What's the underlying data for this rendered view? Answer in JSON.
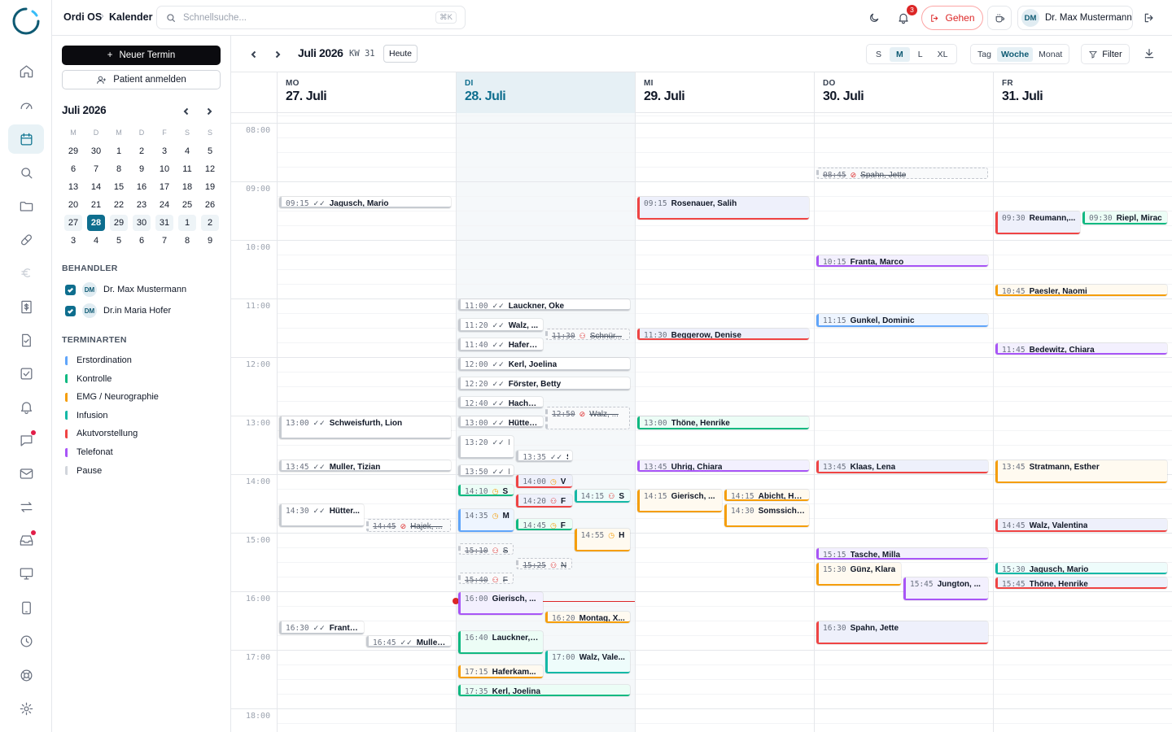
{
  "app": {
    "name": "Ordi OS",
    "page": "Kalender"
  },
  "search": {
    "placeholder": "Schnellsuche...",
    "shortcut": "⌘K"
  },
  "notifications": {
    "count": "3"
  },
  "header": {
    "gehen_label": "Gehen",
    "user_initials": "DM",
    "user_name": "Dr. Max Mustermann"
  },
  "sidebar": {
    "new_appointment": "Neuer Termin",
    "register_patient": "Patient anmelden",
    "mini_month": "Juli 2026",
    "weekdays": [
      "M",
      "D",
      "M",
      "D",
      "F",
      "S",
      "S"
    ],
    "weeks": [
      [
        "29",
        "30",
        "1",
        "2",
        "3",
        "4",
        "5"
      ],
      [
        "6",
        "7",
        "8",
        "9",
        "10",
        "11",
        "12"
      ],
      [
        "13",
        "14",
        "15",
        "16",
        "17",
        "18",
        "19"
      ],
      [
        "20",
        "21",
        "22",
        "23",
        "24",
        "25",
        "26"
      ],
      [
        "27",
        "28",
        "29",
        "30",
        "31",
        "1",
        "2"
      ],
      [
        "3",
        "4",
        "5",
        "6",
        "7",
        "8",
        "9"
      ]
    ],
    "providers_title": "BEHANDLER",
    "providers": [
      {
        "initials": "DM",
        "name": "Dr. Max Mustermann",
        "checked": true
      },
      {
        "initials": "DM",
        "name": "Dr.in Maria Hofer",
        "checked": true
      }
    ],
    "types_title": "TERMINARTEN",
    "types": [
      {
        "name": "Erstordination",
        "color": "#60a5fa"
      },
      {
        "name": "Kontrolle",
        "color": "#10b981"
      },
      {
        "name": "EMG / Neurographie",
        "color": "#f59e0b"
      },
      {
        "name": "Infusion",
        "color": "#14b8a6"
      },
      {
        "name": "Akutvorstellung",
        "color": "#ef4444"
      },
      {
        "name": "Telefonat",
        "color": "#a855f7"
      },
      {
        "name": "Pause",
        "color": "#d1d5db"
      }
    ]
  },
  "calendar": {
    "month_label": "Juli 2026",
    "week_label": "KW 31",
    "today_label": "Heute",
    "sizes": [
      "S",
      "M",
      "L",
      "XL"
    ],
    "active_size": "M",
    "views": [
      "Tag",
      "Woche",
      "Monat"
    ],
    "active_view": "Woche",
    "filter_label": "Filter",
    "days": [
      {
        "weekday": "MO",
        "date": "27. Juli",
        "today": false
      },
      {
        "weekday": "DI",
        "date": "28. Juli",
        "today": true
      },
      {
        "weekday": "MI",
        "date": "29. Juli",
        "today": false
      },
      {
        "weekday": "DO",
        "date": "30. Juli",
        "today": false
      },
      {
        "weekday": "FR",
        "date": "31. Juli",
        "today": false
      }
    ],
    "hours": [
      "08:00",
      "09:00",
      "10:00",
      "11:00",
      "12:00",
      "13:00",
      "14:00",
      "15:00",
      "16:00",
      "17:00",
      "18:00"
    ],
    "appointments": [
      {
        "day": 0,
        "start": "09:15",
        "mins": 12,
        "lane": 0,
        "lanes": 1,
        "name": "Jagusch, Mario",
        "status": "check",
        "kind": "pause"
      },
      {
        "day": 0,
        "start": "13:00",
        "mins": 25,
        "lane": 0,
        "lanes": 1,
        "name": "Schweisfurth, Lion",
        "status": "check",
        "kind": "pause"
      },
      {
        "day": 0,
        "start": "13:45",
        "mins": 12,
        "lane": 0,
        "lanes": 1,
        "name": "Muller, Tizian",
        "status": "check",
        "kind": "pause"
      },
      {
        "day": 0,
        "start": "14:30",
        "mins": 25,
        "lane": 0,
        "lanes": 2,
        "name": "Hütter...",
        "status": "check",
        "kind": "pause"
      },
      {
        "day": 0,
        "start": "14:45",
        "mins": 15,
        "lane": 1,
        "lanes": 2,
        "name": "Hajek, ...",
        "status": "noshow",
        "kind": "cancel"
      },
      {
        "day": 0,
        "start": "16:30",
        "mins": 15,
        "lane": 0,
        "lanes": 2,
        "name": "Franta,...",
        "status": "check",
        "kind": "pause"
      },
      {
        "day": 0,
        "start": "16:45",
        "mins": 12,
        "lane": 1,
        "lanes": 2,
        "name": "Muller, ...",
        "status": "check",
        "kind": "pause"
      },
      {
        "day": 1,
        "start": "11:00",
        "mins": 12,
        "lane": 0,
        "lanes": 1,
        "name": "Lauckner, Oke",
        "status": "check",
        "kind": "pause"
      },
      {
        "day": 1,
        "start": "11:20",
        "mins": 15,
        "lane": 0,
        "lanes": 2,
        "name": "Walz, ...",
        "status": "check",
        "kind": "pause"
      },
      {
        "day": 1,
        "start": "11:30",
        "mins": 12,
        "lane": 1,
        "lanes": 2,
        "name": "Schnür...",
        "status": "person",
        "kind": "cancel"
      },
      {
        "day": 1,
        "start": "11:40",
        "mins": 15,
        "lane": 0,
        "lanes": 2,
        "name": "Haferk...",
        "status": "check",
        "kind": "pause"
      },
      {
        "day": 1,
        "start": "12:00",
        "mins": 15,
        "lane": 0,
        "lanes": 1,
        "name": "Kerl, Joelina",
        "status": "check",
        "kind": "pause"
      },
      {
        "day": 1,
        "start": "12:20",
        "mins": 15,
        "lane": 0,
        "lanes": 1,
        "name": "Förster, Betty",
        "status": "check",
        "kind": "pause"
      },
      {
        "day": 1,
        "start": "12:40",
        "mins": 12,
        "lane": 0,
        "lanes": 2,
        "name": "Hache,...",
        "status": "check",
        "kind": "pause"
      },
      {
        "day": 1,
        "start": "12:50",
        "mins": 25,
        "lane": 1,
        "lanes": 2,
        "name": "Walz, ...",
        "status": "noshow",
        "kind": "cancel"
      },
      {
        "day": 1,
        "start": "13:00",
        "mins": 12,
        "lane": 0,
        "lanes": 2,
        "name": "Hütter,...",
        "status": "check",
        "kind": "pause"
      },
      {
        "day": 1,
        "start": "13:20",
        "mins": 25,
        "lane": 0,
        "lanes": 3,
        "name": "F",
        "status": "check",
        "kind": "pause"
      },
      {
        "day": 1,
        "start": "13:35",
        "mins": 12,
        "lane": 1,
        "lanes": 3,
        "name": "S",
        "status": "check",
        "kind": "pause"
      },
      {
        "day": 1,
        "start": "13:50",
        "mins": 10,
        "lane": 0,
        "lanes": 3,
        "name": "I",
        "status": "check",
        "kind": "pause"
      },
      {
        "day": 1,
        "start": "14:00",
        "mins": 15,
        "lane": 1,
        "lanes": 3,
        "name": "V",
        "status": "clock",
        "kind": "akut"
      },
      {
        "day": 1,
        "start": "14:10",
        "mins": 10,
        "lane": 0,
        "lanes": 3,
        "name": "S",
        "status": "clock",
        "kind": "kontrolle"
      },
      {
        "day": 1,
        "start": "14:15",
        "mins": 15,
        "lane": 2,
        "lanes": 3,
        "name": "S",
        "status": "person",
        "kind": "infusion"
      },
      {
        "day": 1,
        "start": "14:20",
        "mins": 15,
        "lane": 1,
        "lanes": 3,
        "name": "F",
        "status": "person",
        "kind": "akut"
      },
      {
        "day": 1,
        "start": "14:35",
        "mins": 25,
        "lane": 0,
        "lanes": 3,
        "name": "M",
        "status": "clock",
        "kind": "erst"
      },
      {
        "day": 1,
        "start": "14:45",
        "mins": 10,
        "lane": 1,
        "lanes": 3,
        "name": "F",
        "status": "clock",
        "kind": "kontrolle"
      },
      {
        "day": 1,
        "start": "14:55",
        "mins": 25,
        "lane": 2,
        "lanes": 3,
        "name": "H",
        "status": "clock",
        "kind": "emg"
      },
      {
        "day": 1,
        "start": "15:10",
        "mins": 10,
        "lane": 0,
        "lanes": 3,
        "name": "S",
        "status": "person",
        "kind": "cancel"
      },
      {
        "day": 1,
        "start": "15:25",
        "mins": 10,
        "lane": 1,
        "lanes": 3,
        "name": "N",
        "status": "person",
        "kind": "cancel"
      },
      {
        "day": 1,
        "start": "15:40",
        "mins": 8,
        "lane": 0,
        "lanes": 3,
        "name": "F",
        "status": "person",
        "kind": "cancel"
      },
      {
        "day": 1,
        "start": "16:00",
        "mins": 25,
        "lane": 0,
        "lanes": 2,
        "name": "Gierisch, ...",
        "status": "",
        "kind": "telefonat"
      },
      {
        "day": 1,
        "start": "16:20",
        "mins": 12,
        "lane": 1,
        "lanes": 2,
        "name": "Montag, X...",
        "status": "",
        "kind": "emg"
      },
      {
        "day": 1,
        "start": "16:40",
        "mins": 25,
        "lane": 0,
        "lanes": 2,
        "name": "Lauckner, ...",
        "status": "",
        "kind": "kontrolle"
      },
      {
        "day": 1,
        "start": "17:00",
        "mins": 25,
        "lane": 1,
        "lanes": 2,
        "name": "Walz, Vale...",
        "status": "",
        "kind": "infusion"
      },
      {
        "day": 1,
        "start": "17:15",
        "mins": 15,
        "lane": 0,
        "lanes": 2,
        "name": "Haferkam...",
        "status": "",
        "kind": "emg"
      },
      {
        "day": 1,
        "start": "17:35",
        "mins": 12,
        "lane": 0,
        "lanes": 1,
        "name": "Kerl, Joelina",
        "status": "",
        "kind": "kontrolle"
      },
      {
        "day": 2,
        "start": "09:15",
        "mins": 25,
        "lane": 0,
        "lanes": 1,
        "name": "Rosenauer, Salih",
        "status": "",
        "kind": "akut"
      },
      {
        "day": 2,
        "start": "11:30",
        "mins": 12,
        "lane": 0,
        "lanes": 1,
        "name": "Beggerow, Denise",
        "status": "",
        "kind": "akut"
      },
      {
        "day": 2,
        "start": "13:00",
        "mins": 15,
        "lane": 0,
        "lanes": 1,
        "name": "Thöne, Henrike",
        "status": "",
        "kind": "kontrolle"
      },
      {
        "day": 2,
        "start": "13:45",
        "mins": 12,
        "lane": 0,
        "lanes": 1,
        "name": "Uhrig, Chiara",
        "status": "",
        "kind": "telefonat"
      },
      {
        "day": 2,
        "start": "14:15",
        "mins": 25,
        "lane": 0,
        "lanes": 2,
        "name": "Gierisch, ...",
        "status": "",
        "kind": "emg"
      },
      {
        "day": 2,
        "start": "14:15",
        "mins": 12,
        "lane": 1,
        "lanes": 2,
        "name": "Abicht, He...",
        "status": "",
        "kind": "emg"
      },
      {
        "day": 2,
        "start": "14:30",
        "mins": 25,
        "lane": 1,
        "lanes": 2,
        "name": "Somssich,...",
        "status": "",
        "kind": "emg"
      },
      {
        "day": 3,
        "start": "08:45",
        "mins": 8,
        "lane": 0,
        "lanes": 1,
        "name": "Spahn, Jette",
        "status": "noshow",
        "kind": "cancel"
      },
      {
        "day": 3,
        "start": "10:15",
        "mins": 12,
        "lane": 0,
        "lanes": 1,
        "name": "Franta, Marco",
        "status": "",
        "kind": "telefonat"
      },
      {
        "day": 3,
        "start": "11:15",
        "mins": 15,
        "lane": 0,
        "lanes": 1,
        "name": "Gunkel, Dominic",
        "status": "",
        "kind": "erst"
      },
      {
        "day": 3,
        "start": "13:45",
        "mins": 15,
        "lane": 0,
        "lanes": 1,
        "name": "Klaas, Lena",
        "status": "",
        "kind": "akut"
      },
      {
        "day": 3,
        "start": "15:15",
        "mins": 12,
        "lane": 0,
        "lanes": 1,
        "name": "Tasche, Milla",
        "status": "",
        "kind": "telefonat"
      },
      {
        "day": 3,
        "start": "15:30",
        "mins": 25,
        "lane": 0,
        "lanes": 2,
        "name": "Günz, Klara",
        "status": "",
        "kind": "emg"
      },
      {
        "day": 3,
        "start": "15:45",
        "mins": 25,
        "lane": 1,
        "lanes": 2,
        "name": "Jungton, ...",
        "status": "",
        "kind": "telefonat"
      },
      {
        "day": 3,
        "start": "16:30",
        "mins": 25,
        "lane": 0,
        "lanes": 1,
        "name": "Spahn, Jette",
        "status": "",
        "kind": "akut"
      },
      {
        "day": 4,
        "start": "09:30",
        "mins": 25,
        "lane": 0,
        "lanes": 2,
        "name": "Reumann,...",
        "status": "",
        "kind": "akut"
      },
      {
        "day": 4,
        "start": "09:30",
        "mins": 15,
        "lane": 1,
        "lanes": 2,
        "name": "Riepl, Mirac",
        "status": "",
        "kind": "kontrolle"
      },
      {
        "day": 4,
        "start": "10:45",
        "mins": 12,
        "lane": 0,
        "lanes": 1,
        "name": "Paesler, Naomi",
        "status": "",
        "kind": "emg"
      },
      {
        "day": 4,
        "start": "11:45",
        "mins": 12,
        "lane": 0,
        "lanes": 1,
        "name": "Bedewitz, Chiara",
        "status": "",
        "kind": "telefonat"
      },
      {
        "day": 4,
        "start": "13:45",
        "mins": 25,
        "lane": 0,
        "lanes": 1,
        "name": "Stratmann, Esther",
        "status": "",
        "kind": "emg"
      },
      {
        "day": 4,
        "start": "14:45",
        "mins": 15,
        "lane": 0,
        "lanes": 1,
        "name": "Walz, Valentina",
        "status": "",
        "kind": "akut"
      },
      {
        "day": 4,
        "start": "15:30",
        "mins": 10,
        "lane": 0,
        "lanes": 1,
        "name": "Jagusch, Mario",
        "status": "",
        "kind": "infusion"
      },
      {
        "day": 4,
        "start": "15:45",
        "mins": 12,
        "lane": 0,
        "lanes": 1,
        "name": "Thöne, Henrike",
        "status": "",
        "kind": "akut"
      }
    ],
    "kind_colors": {
      "pause": "#c7cbd1",
      "cancel": "#c4c8cf",
      "erst": "#60a5fa",
      "kontrolle": "#10b981",
      "emg": "#f59e0b",
      "infusion": "#14b8a6",
      "akut": "#ef4444",
      "telefonat": "#a855f7"
    },
    "kind_bg": {
      "pause": "#ffffff",
      "cancel": "#f9fafb",
      "erst": "#eef5ff",
      "kontrolle": "#ecfdf6",
      "emg": "#fffaf0",
      "infusion": "#eefcfb",
      "akut": "#eef0fb",
      "telefonat": "#f3f0fe"
    },
    "now_time": "16:10"
  }
}
